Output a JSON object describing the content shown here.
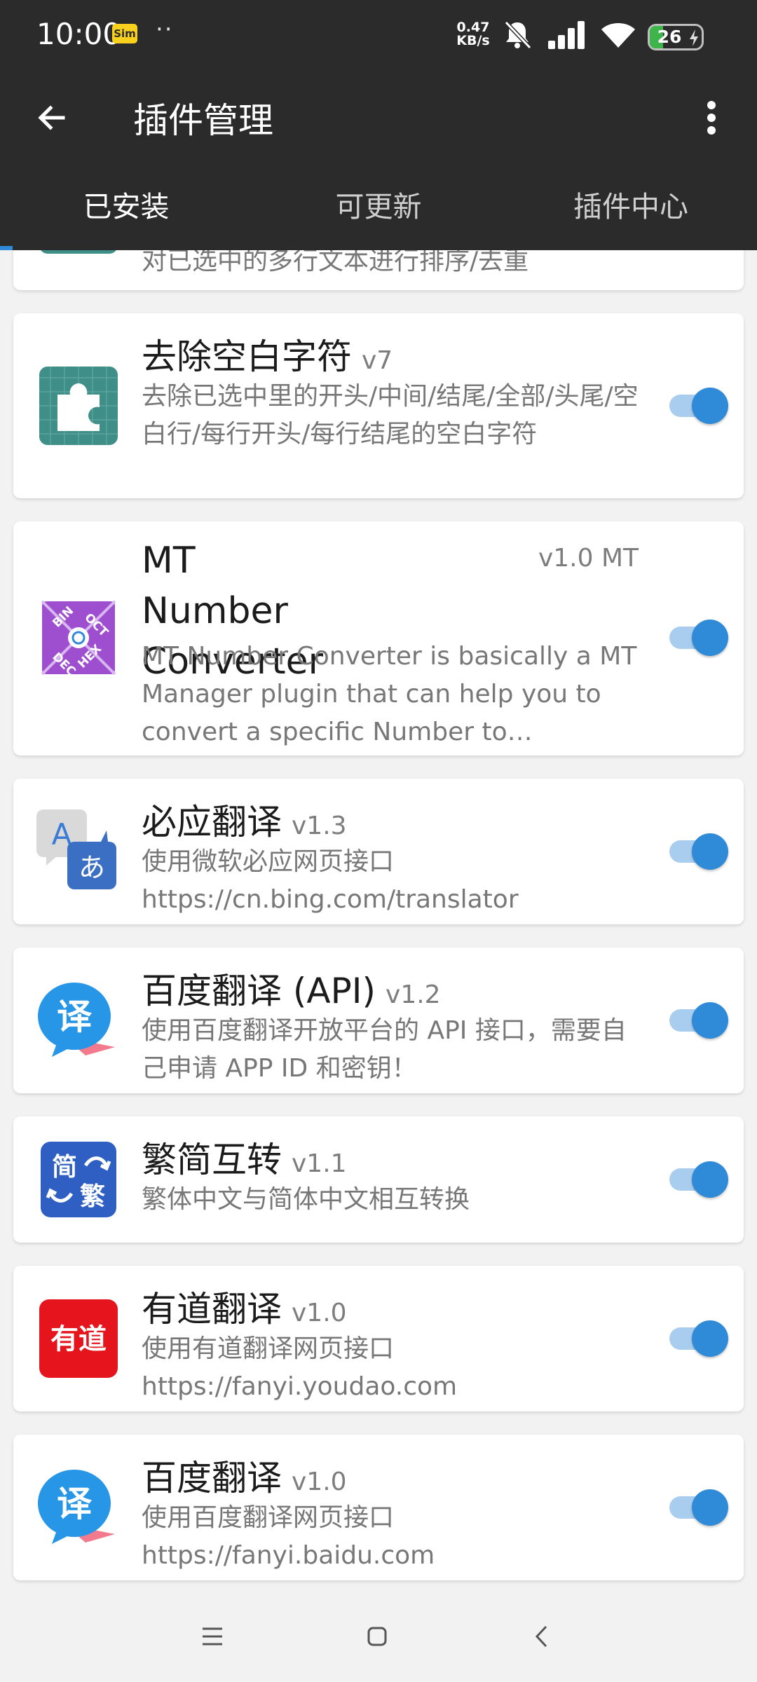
{
  "status_bar": {
    "time": "10:00",
    "sim_badge": "Sim",
    "dots": "··",
    "net_speed_value": "0.47",
    "net_speed_unit": "KB/s",
    "battery_level": "26",
    "battery_fraction": 0.26,
    "icons": [
      "mute-bell-icon",
      "signal-icon",
      "wifi-icon",
      "battery-charging-icon"
    ]
  },
  "appbar": {
    "title": "插件管理",
    "back_icon": "arrow-back-icon",
    "more_icon": "more-vert-icon"
  },
  "tabs": [
    {
      "label": "已安装",
      "active": true
    },
    {
      "label": "可更新",
      "active": false
    },
    {
      "label": "插件中心",
      "active": false
    }
  ],
  "colors": {
    "topbar": "#2b2b2b",
    "accent": "#2f8bd8",
    "background": "#f2f2f2"
  },
  "plugins": [
    {
      "title": "",
      "version": "",
      "description": "对已选中的多行文本进行排序/去重",
      "enabled": true,
      "icon": "puzzle-icon"
    },
    {
      "title": "去除空白字符",
      "version": "v7",
      "description": "去除已选中里的开头/中间/结尾/全部/头尾/空白行/每行开头/每行结尾的空白字符",
      "enabled": true,
      "icon": "puzzle-icon"
    },
    {
      "title": "MT Number Converter",
      "version": "v1.0 MT",
      "description": "MT Number Converter is basically a MT Manager plugin that can help you to convert a specific Number to…",
      "enabled": true,
      "icon": "number-converter-icon"
    },
    {
      "title": "必应翻译",
      "version": "v1.3",
      "description": "使用微软必应网页接口 https://cn.bing.com/translator",
      "enabled": true,
      "icon": "translate-icon"
    },
    {
      "title": "百度翻译 (API)",
      "version": "v1.2",
      "description": "使用百度翻译开放平台的 API 接口，需要自己申请 APP ID 和密钥！",
      "enabled": true,
      "icon": "baidu-translate-icon"
    },
    {
      "title": "繁简互转",
      "version": "v1.1",
      "description": "繁体中文与简体中文相互转换",
      "enabled": true,
      "icon": "simplified-traditional-icon"
    },
    {
      "title": "有道翻译",
      "version": "v1.0",
      "description": "使用有道翻译网页接口 https://fanyi.youdao.com",
      "enabled": true,
      "icon": "youdao-icon"
    },
    {
      "title": "百度翻译",
      "version": "v1.0",
      "description": "使用百度翻译网页接口 https://fanyi.baidu.com",
      "enabled": true,
      "icon": "baidu-translate-icon"
    }
  ],
  "icon_text": {
    "bin": "BIN",
    "oct": "OCT",
    "dec": "DEC",
    "hex": "HEX",
    "translate_a": "A",
    "translate_ja": "あ",
    "baidu_yi": "译",
    "jian": "简",
    "fan": "繁",
    "youdao": "有道"
  },
  "navbar": {
    "icons": [
      "menu-icon",
      "home-icon",
      "back-nav-icon"
    ]
  }
}
